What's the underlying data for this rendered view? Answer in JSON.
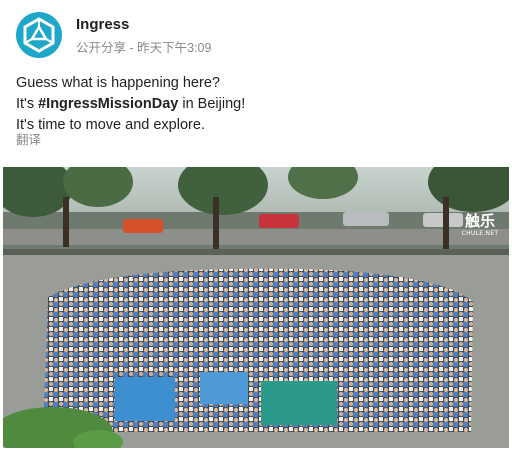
{
  "post": {
    "author": "Ingress",
    "visibility": "公开分享",
    "separator": " - ",
    "time": "昨天下午3:09",
    "lines": {
      "l1": "Guess what is happening here?",
      "l2_pre": "It's ",
      "l2_tag": "#IngressMissionDay",
      "l2_post": " in Beijing!",
      "l3": "It's time to move and explore."
    },
    "translate_label": "翻译"
  },
  "photo": {
    "description_icon": "group-photo",
    "watermark_big": "触乐",
    "watermark_small": "CHULE.NET"
  },
  "colors": {
    "brand": "#1fa7c9",
    "text": "#212121",
    "meta": "#8a8a8a"
  }
}
